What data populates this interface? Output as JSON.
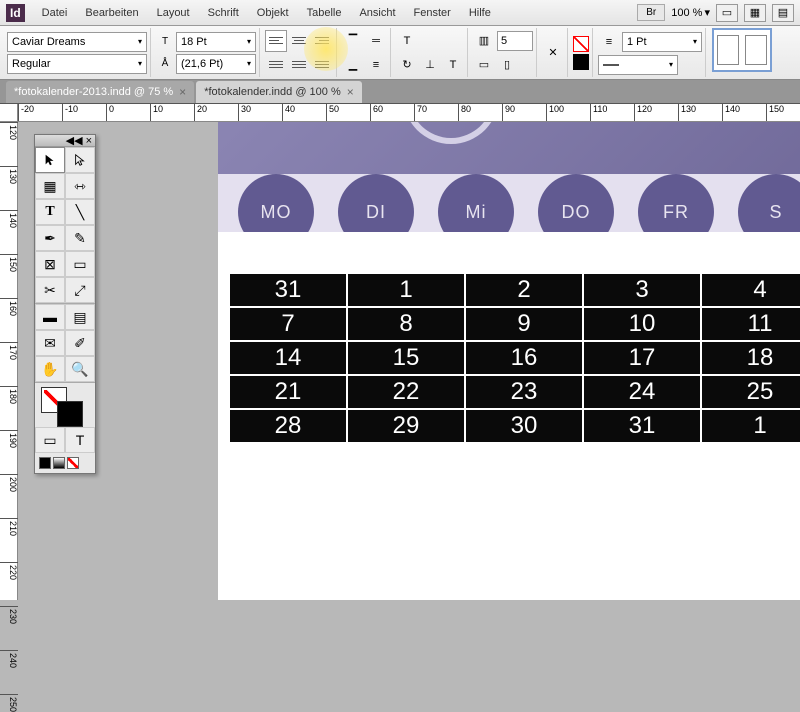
{
  "app": "Id",
  "menu": [
    "Datei",
    "Bearbeiten",
    "Layout",
    "Schrift",
    "Objekt",
    "Tabelle",
    "Ansicht",
    "Fenster",
    "Hilfe"
  ],
  "menu_right": {
    "br": "Br",
    "zoom": "100 %"
  },
  "control": {
    "font": "Caviar Dreams",
    "style": "Regular",
    "size": "18 Pt",
    "leading": "(21,6 Pt)",
    "columns": "5",
    "stroke_weight": "1 Pt"
  },
  "tabs": [
    {
      "label": "*fotokalender-2013.indd @ 75 %",
      "active": false
    },
    {
      "label": "*fotokalender.indd @ 100 %",
      "active": true
    }
  ],
  "ruler_h": [
    -20,
    -10,
    0,
    10,
    20,
    30,
    40,
    50,
    60,
    70,
    80,
    90,
    100,
    110,
    120,
    130,
    140,
    150
  ],
  "ruler_v": [
    120,
    130,
    140,
    150,
    160,
    170,
    180,
    190,
    200,
    210,
    220,
    230,
    240,
    250
  ],
  "days": [
    "MO",
    "DI",
    "Mi",
    "DO",
    "FR",
    "S"
  ],
  "calendar": [
    [
      "31",
      "1",
      "2",
      "3",
      "4"
    ],
    [
      "7",
      "8",
      "9",
      "10",
      "11"
    ],
    [
      "14",
      "15",
      "16",
      "17",
      "18"
    ],
    [
      "21",
      "22",
      "23",
      "24",
      "25"
    ],
    [
      "28",
      "29",
      "30",
      "31",
      "1"
    ]
  ]
}
